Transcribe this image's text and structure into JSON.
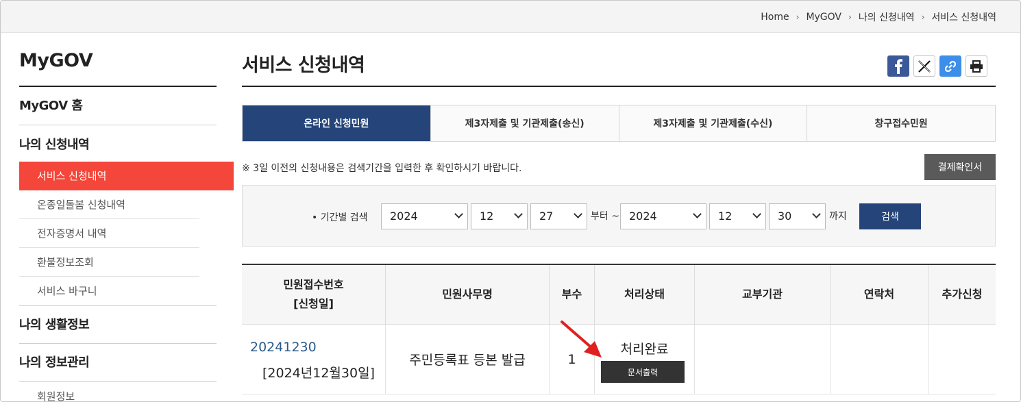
{
  "breadcrumb": [
    "Home",
    "MyGOV",
    "나의 신청내역",
    "서비스 신청내역"
  ],
  "sidebar": {
    "title": "MyGOV",
    "home": "MyGOV 홈",
    "section1": "나의 신청내역",
    "items": [
      "서비스 신청내역",
      "온종일돌봄 신청내역",
      "전자증명서 내역",
      "환불정보조회",
      "서비스 바구니"
    ],
    "section2": "나의 생활정보",
    "section3": "나의 정보관리",
    "section3_items": [
      "회원정보"
    ]
  },
  "page": {
    "title": "서비스 신청내역",
    "share_icons": [
      "facebook-icon",
      "x-icon",
      "link-icon",
      "print-icon"
    ],
    "tabs": [
      "온라인 신청민원",
      "제3자제출 및 기관제출(송신)",
      "제3자제출 및 기관제출(수신)",
      "창구접수민원"
    ],
    "notice": "※ 3일 이전의 신청내용은 검색기간을 입력한 후 확인하시기 바랍니다.",
    "pay_button": "결제확인서"
  },
  "search": {
    "label": "• 기간별 검색",
    "from_year": "2024",
    "from_month": "12",
    "from_day": "27",
    "from_text": "부터 ~",
    "to_year": "2024",
    "to_month": "12",
    "to_day": "30",
    "to_text": "까지",
    "button": "검색"
  },
  "table": {
    "headers": [
      "민원접수번호",
      "[신청일]",
      "민원사무명",
      "부수",
      "처리상태",
      "교부기관",
      "연락처",
      "추가신청"
    ],
    "rows": [
      {
        "receipt_no": "20241230",
        "date": "[2024년12월30일]",
        "name": "주민등록표 등본 발급",
        "copies": "1",
        "status": "처리완료",
        "print_button": "문서출력"
      }
    ]
  },
  "colors": {
    "accent": "#25447a",
    "active_menu": "#f4463a",
    "arrow": "#e02020"
  }
}
